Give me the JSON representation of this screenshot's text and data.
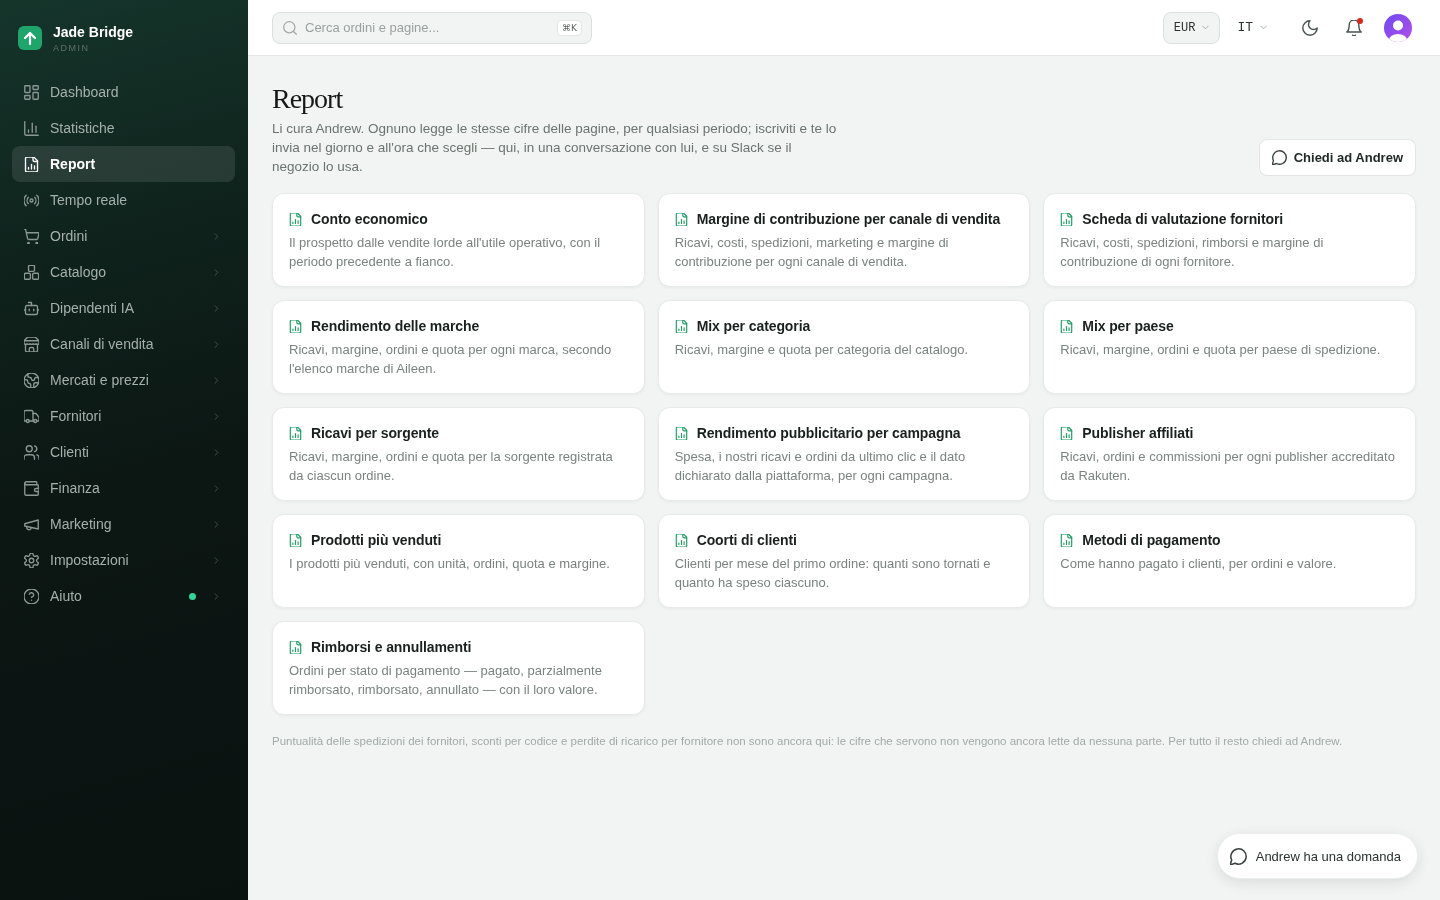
{
  "sidebar": {
    "brand": {
      "name": "Jade Bridge",
      "role": "ADMIN"
    },
    "items": [
      {
        "label": "Dashboard",
        "selected": false,
        "has_submenu": false,
        "notice": false
      },
      {
        "label": "Statistiche",
        "selected": false,
        "has_submenu": false,
        "notice": false
      },
      {
        "label": "Report",
        "selected": true,
        "has_submenu": false,
        "notice": false
      },
      {
        "label": "Tempo reale",
        "selected": false,
        "has_submenu": false,
        "notice": false
      },
      {
        "label": "Ordini",
        "selected": false,
        "has_submenu": true,
        "notice": false
      },
      {
        "label": "Catalogo",
        "selected": false,
        "has_submenu": true,
        "notice": false
      },
      {
        "label": "Dipendenti IA",
        "selected": false,
        "has_submenu": true,
        "notice": false
      },
      {
        "label": "Canali di vendita",
        "selected": false,
        "has_submenu": true,
        "notice": false
      },
      {
        "label": "Mercati e prezzi",
        "selected": false,
        "has_submenu": true,
        "notice": false
      },
      {
        "label": "Fornitori",
        "selected": false,
        "has_submenu": true,
        "notice": false
      },
      {
        "label": "Clienti",
        "selected": false,
        "has_submenu": true,
        "notice": false
      },
      {
        "label": "Finanza",
        "selected": false,
        "has_submenu": true,
        "notice": false
      },
      {
        "label": "Marketing",
        "selected": false,
        "has_submenu": true,
        "notice": false
      },
      {
        "label": "Impostazioni",
        "selected": false,
        "has_submenu": true,
        "notice": false
      },
      {
        "label": "Aiuto",
        "selected": false,
        "has_submenu": true,
        "notice": true
      }
    ]
  },
  "topbar": {
    "search": {
      "placeholder": "Cerca ordini e pagine...",
      "shortcut": "⌘K"
    },
    "currency": "EUR",
    "language": "IT",
    "notifications": {
      "unread": true
    }
  },
  "page": {
    "title": "Report",
    "description": "Li cura Andrew. Ognuno legge le stesse cifre delle pagine, per qualsiasi periodo; iscriviti e te lo invia nel giorno e all'ora che scegli — qui, in una conversazione con lui, e su Slack se il negozio lo usa.",
    "ask_button": "Chiedi ad Andrew",
    "reports": [
      {
        "title": "Conto economico",
        "description": "Il prospetto dalle vendite lorde all'utile operativo, con il periodo precedente a fianco."
      },
      {
        "title": "Margine di contribuzione per canale di vendita",
        "description": "Ricavi, costi, spedizioni, marketing e margine di contribuzione per ogni canale di vendita."
      },
      {
        "title": "Scheda di valutazione fornitori",
        "description": "Ricavi, costi, spedizioni, rimborsi e margine di contribuzione di ogni fornitore."
      },
      {
        "title": "Rendimento delle marche",
        "description": "Ricavi, margine, ordini e quota per ogni marca, secondo l'elenco marche di Aileen."
      },
      {
        "title": "Mix per categoria",
        "description": "Ricavi, margine e quota per categoria del catalogo."
      },
      {
        "title": "Mix per paese",
        "description": "Ricavi, margine, ordini e quota per paese di spedizione."
      },
      {
        "title": "Ricavi per sorgente",
        "description": "Ricavi, margine, ordini e quota per la sorgente registrata da ciascun ordine."
      },
      {
        "title": "Rendimento pubblicitario per campagna",
        "description": "Spesa, i nostri ricavi e ordini da ultimo clic e il dato dichiarato dalla piattaforma, per ogni campagna."
      },
      {
        "title": "Publisher affiliati",
        "description": "Ricavi, ordini e commissioni per ogni publisher accreditato da Rakuten."
      },
      {
        "title": "Prodotti più venduti",
        "description": "I prodotti più venduti, con unità, ordini, quota e margine."
      },
      {
        "title": "Coorti di clienti",
        "description": "Clienti per mese del primo ordine: quanti sono tornati e quanto ha speso ciascuno."
      },
      {
        "title": "Metodi di pagamento",
        "description": "Come hanno pagato i clienti, per ordini e valore."
      },
      {
        "title": "Rimborsi e annullamenti",
        "description": "Ordini per stato di pagamento — pagato, parzialmente rimborsato, rimborsato, annullato — con il loro valore."
      }
    ],
    "footnote": "Puntualità delle spedizioni dei fornitori, sconti per codice e perdite di ricarico per fornitore non sono ancora qui: le cifre che servono non vengono ancora lette da nessuna parte. Per tutto il resto chiedi ad Andrew."
  },
  "chat_button": "Andrew ha una domanda"
}
